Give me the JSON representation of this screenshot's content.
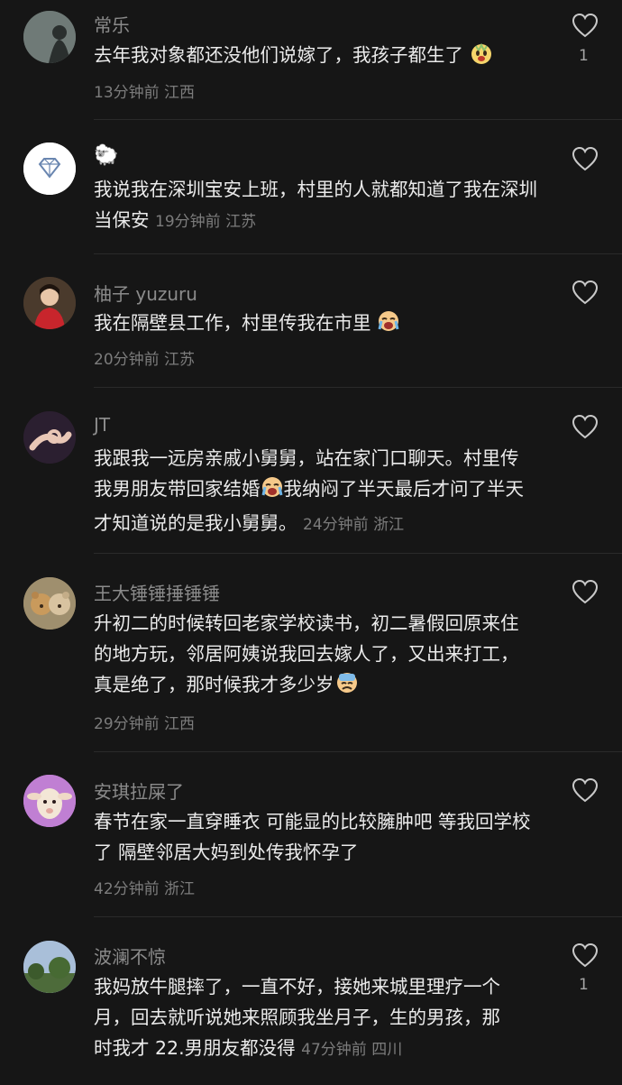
{
  "comments": [
    {
      "name": "常乐",
      "text": "去年我对象都还没他们说嫁了，我孩子都生了",
      "emoji": "laugh-cry-emoji",
      "time": "13分钟前",
      "location": "江西",
      "likes": "1",
      "avatar": "avatar-silhouette"
    },
    {
      "name": "🐑",
      "text": "我说我在深圳宝安上班，村里的人就都知道了我在深圳当保安",
      "time": "19分钟前",
      "location": "江苏",
      "likes": "",
      "avatar": "avatar-diamond"
    },
    {
      "name": "柚子 yuzuru",
      "text": "我在隔壁县工作，村里传我在市里",
      "emoji": "crying-emoji",
      "time": "20分钟前",
      "location": "江苏",
      "likes": "",
      "avatar": "avatar-girl-red"
    },
    {
      "name": "JT",
      "text_1": "我跟我一远房亲戚小舅舅，站在家门口聊天。村里传我男朋友带回家结婚",
      "text_2": "我纳闷了半天最后才问了半天才知道说的是我小舅舅。",
      "emoji": "crying-emoji",
      "time": "24分钟前",
      "location": "浙江",
      "likes": "",
      "avatar": "avatar-hand"
    },
    {
      "name": "王大锤锤捶锤锤",
      "text": "升初二的时候转回老家学校读书，初二暑假回原来住的地方玩，邻居阿姨说我回去嫁人了，又出来打工，真是绝了，那时候我才多少岁",
      "emoji": "sweat-emoji",
      "time": "29分钟前",
      "location": "江西",
      "likes": "",
      "avatar": "avatar-teddy-bears"
    },
    {
      "name": "安琪拉屎了",
      "text": "春节在家一直穿睡衣 可能显的比较臃肿吧 等我回学校了 隔壁邻居大妈到处传我怀孕了",
      "time": "42分钟前",
      "location": "浙江",
      "likes": "",
      "avatar": "avatar-sheep"
    },
    {
      "name": "波澜不惊",
      "text": "我妈放牛腿摔了，一直不好，接她来城里理疗一个月，回去就听说她来照顾我坐月子，生的男孩，那时我才 22.男朋友都没得",
      "time": "47分钟前",
      "location": "四川",
      "likes": "1",
      "avatar": "avatar-landscape"
    }
  ],
  "colors": {
    "background": "#161616",
    "name": "#8b8b8b",
    "text": "#ebebeb",
    "meta": "#7c7c7c"
  },
  "icons": {
    "like": "heart-outline-icon"
  }
}
